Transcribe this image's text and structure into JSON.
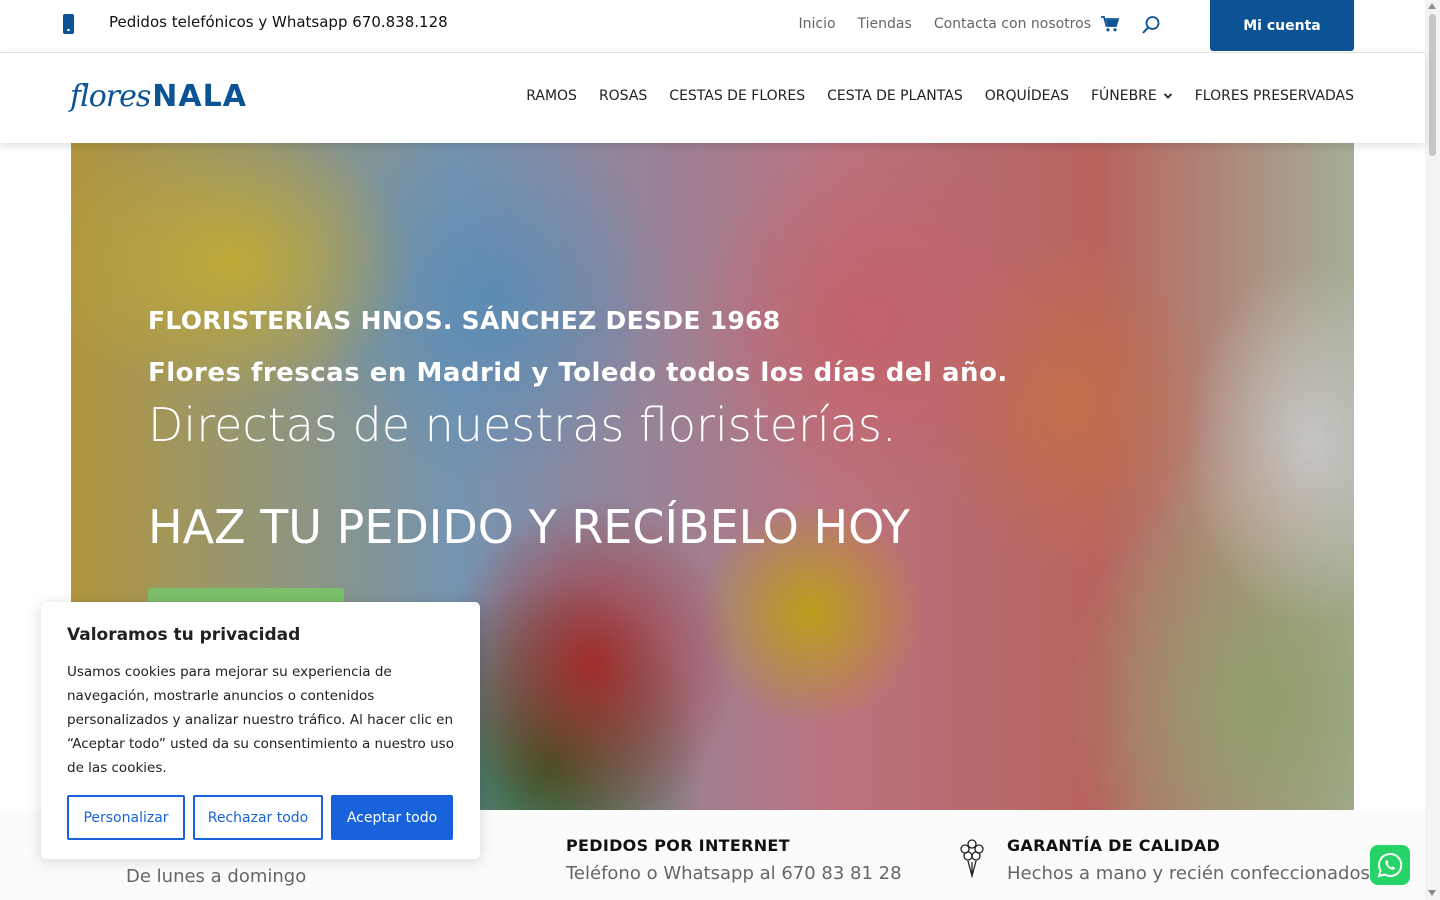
{
  "topbar": {
    "phone_text": "Pedidos telefónicos y Whatsapp 670.838.128",
    "links": [
      "Inicio",
      "Tiendas",
      "Contacta con nosotros"
    ],
    "account_label": "Mi cuenta",
    "cart_icon": "cart-icon",
    "search_icon": "search-icon"
  },
  "header": {
    "logo_script": "flores",
    "logo_bold": "NALA",
    "nav": [
      "RAMOS",
      "ROSAS",
      "CESTAS DE FLORES",
      "CESTA DE PLANTAS",
      "ORQUÍDEAS",
      "FÚNEBRE",
      "FLORES PRESERVADAS"
    ]
  },
  "hero": {
    "subtitle": "FLORISTERÍAS HNOS. SÁNCHEZ DESDE 1968",
    "line": "Flores frescas en Madrid y Toledo todos los días del año.",
    "title": "Directas de nuestras floristerías.",
    "cta_text": "HAZ TU PEDIDO Y RECÍBELO HOY"
  },
  "features": [
    {
      "title": "",
      "text": "De lunes a domingo"
    },
    {
      "title": "PEDIDOS POR INTERNET",
      "text": "Teléfono o Whatsapp al 670 83 81 28"
    },
    {
      "title": "GARANTÍA DE CALIDAD",
      "text": "Hechos a mano y recién confeccionados"
    }
  ],
  "cookie": {
    "title": "Valoramos tu privacidad",
    "text": "Usamos cookies para mejorar su experiencia de navegación, mostrarle anuncios o contenidos personalizados y analizar nuestro tráfico. Al hacer clic en “Aceptar todo” usted da su consentimiento a nuestro uso de las cookies.",
    "customize": "Personalizar",
    "reject": "Rechazar todo",
    "accept": "Aceptar todo"
  },
  "colors": {
    "brand": "#0b5394",
    "cookie_accent": "#1863dc",
    "whatsapp": "#25d366",
    "cta_green": "#7bbf6a"
  }
}
